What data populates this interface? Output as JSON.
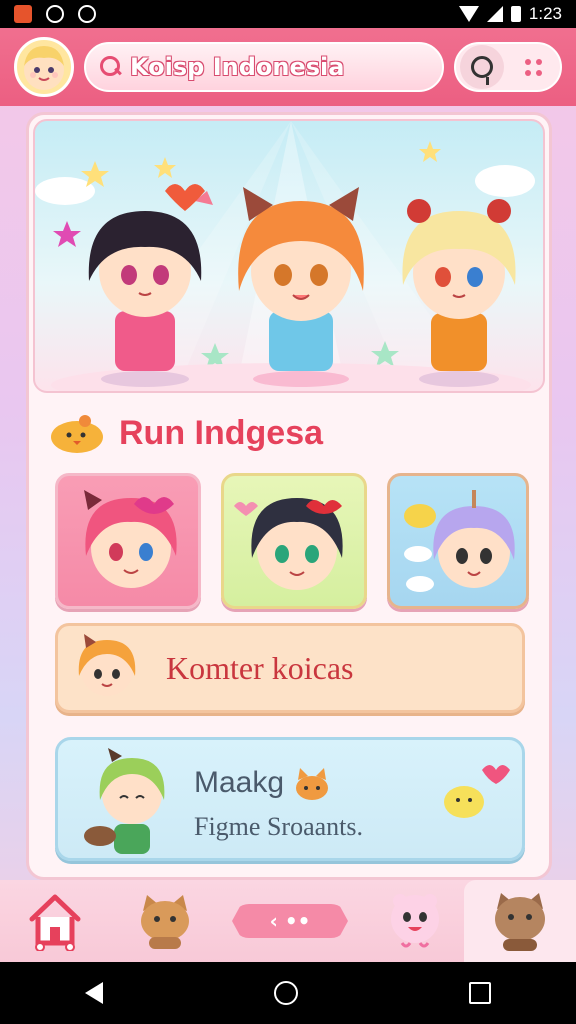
{
  "status_bar": {
    "time": "1:23",
    "icons": [
      "app-notification-icon",
      "circle-status-icon",
      "circle-status-icon",
      "wifi-icon",
      "signal-icon",
      "battery-icon"
    ]
  },
  "header": {
    "search_text": "Koisp Indonesia",
    "buttons": [
      "search-icon",
      "more-dots-icon"
    ]
  },
  "hero": {
    "characters": [
      "black-haired-girl",
      "orange-haired-catgirl",
      "blonde-catgirl"
    ]
  },
  "section": {
    "title": "Run Indgesa",
    "icon": "chick-mascot-icon"
  },
  "tiles": [
    {
      "name": "pink-haired-character",
      "accent": "#f58aa7"
    },
    {
      "name": "dark-haired-character",
      "accent": "#d5ef9f"
    },
    {
      "name": "lavender-haired-character",
      "accent": "#a6d6f0"
    }
  ],
  "cards": {
    "komter": {
      "title": "Komter koicas"
    },
    "maakg": {
      "title": "Maakg",
      "subtitle": "Figme Sroaants."
    }
  },
  "bottom_nav": {
    "items": [
      "home-icon",
      "cat-mascot-icon",
      "pet-icon",
      "brown-cat-icon"
    ],
    "center_pill": "‹ ••"
  },
  "colors": {
    "header": "#ec5f82",
    "accent": "#e6415c",
    "card_peach": "#fde2c8",
    "card_blue": "#d8f2fb"
  }
}
